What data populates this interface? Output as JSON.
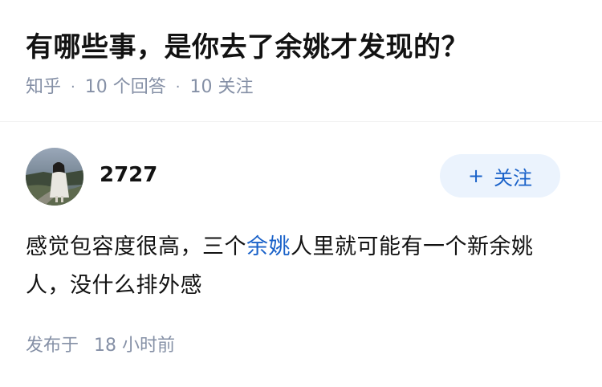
{
  "question": {
    "title": "有哪些事，是你去了余姚才发现的？",
    "source": "知乎",
    "answers": "10 个回答",
    "followers": "10 关注",
    "separator": "·"
  },
  "answer": {
    "author": "2727",
    "follow_label": "关注",
    "follow_icon": "+",
    "content_before": "感觉包容度很高，三个",
    "content_link": "余姚",
    "content_after": "人里就可能有一个新余姚人，没什么排外感",
    "posted_label": "发布于",
    "posted_time": "18 小时前"
  },
  "colors": {
    "accent": "#1a62c9",
    "follow_bg": "#ebf3fd",
    "meta_text": "#8590a6"
  }
}
